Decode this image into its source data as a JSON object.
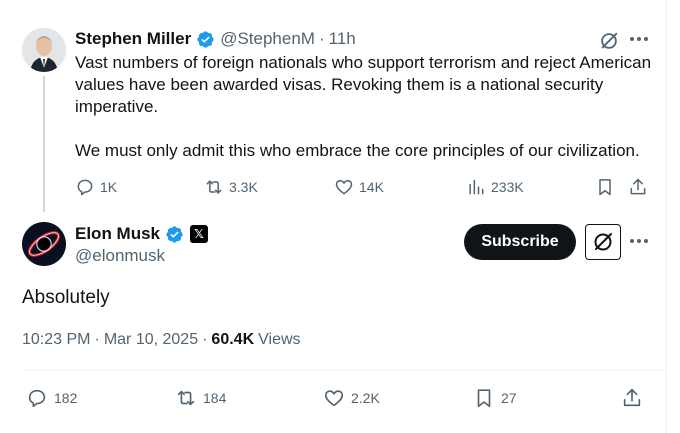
{
  "quoted_tweet": {
    "author_name": "Stephen Miller",
    "author_handle": "@StephenM",
    "time_ago": "11h",
    "separator": "·",
    "paragraphs": [
      "Vast numbers of foreign nationals who support terrorism and reject American values have been awarded visas. Revoking them is a national security imperative.",
      "We must only admit this who embrace the core principles of our civilization."
    ],
    "actions": {
      "replies": "1K",
      "reposts": "3.3K",
      "likes": "14K",
      "views": "233K"
    }
  },
  "main_tweet": {
    "author_name": "Elon Musk",
    "author_handle": "@elonmusk",
    "affiliate_badge": "𝕏",
    "subscribe_label": "Subscribe",
    "text": "Absolutely",
    "time": "10:23 PM",
    "date": "Mar 10, 2025",
    "separator": "·",
    "views_count": "60.4K",
    "views_label": "Views",
    "actions": {
      "replies": "182",
      "reposts": "184",
      "likes": "2.2K",
      "bookmarks": "27"
    }
  },
  "colors": {
    "verified": "#1d9bf0",
    "text_primary": "#0f1419",
    "text_secondary": "#536471",
    "thread_line": "#cfd9de"
  },
  "icons": [
    "verified-badge-icon",
    "grok-icon",
    "more-icon",
    "reply-icon",
    "repost-icon",
    "like-icon",
    "views-icon",
    "bookmark-icon",
    "share-icon",
    "x-affiliate-icon"
  ]
}
